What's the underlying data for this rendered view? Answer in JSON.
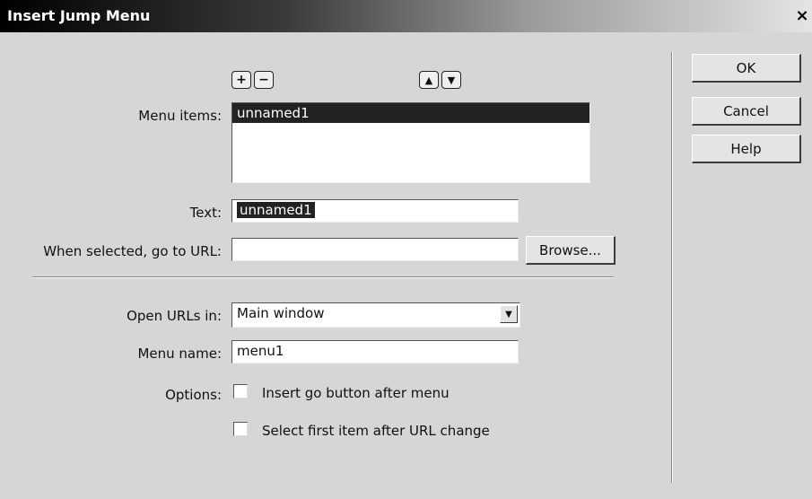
{
  "window": {
    "title": "Insert Jump Menu",
    "close_glyph": "×"
  },
  "toolbar": {
    "add_glyph": "+",
    "remove_glyph": "−",
    "up_glyph": "▲",
    "down_glyph": "▼"
  },
  "menu_items": {
    "label": "Menu items:",
    "items": [
      "unnamed1"
    ],
    "selected_index": 0
  },
  "text": {
    "label": "Text:",
    "value": "unnamed1"
  },
  "url": {
    "label": "When selected, go to URL:",
    "value": "",
    "browse_label": "Browse..."
  },
  "open_in": {
    "label": "Open URLs in:",
    "value": "Main window"
  },
  "menu_name": {
    "label": "Menu name:",
    "value": "menu1"
  },
  "options": {
    "label": "Options:",
    "insert_go_button": {
      "label": "Insert go button after menu",
      "checked": false
    },
    "select_first_item": {
      "label": "Select first item after URL change",
      "checked": false
    }
  },
  "buttons": {
    "ok": "OK",
    "cancel": "Cancel",
    "help": "Help"
  },
  "icons": {
    "add": "plus-icon",
    "remove": "minus-icon",
    "up": "up-arrow-icon",
    "down": "down-arrow-icon",
    "dropdown": "chevron-down-icon",
    "close": "close-icon"
  }
}
